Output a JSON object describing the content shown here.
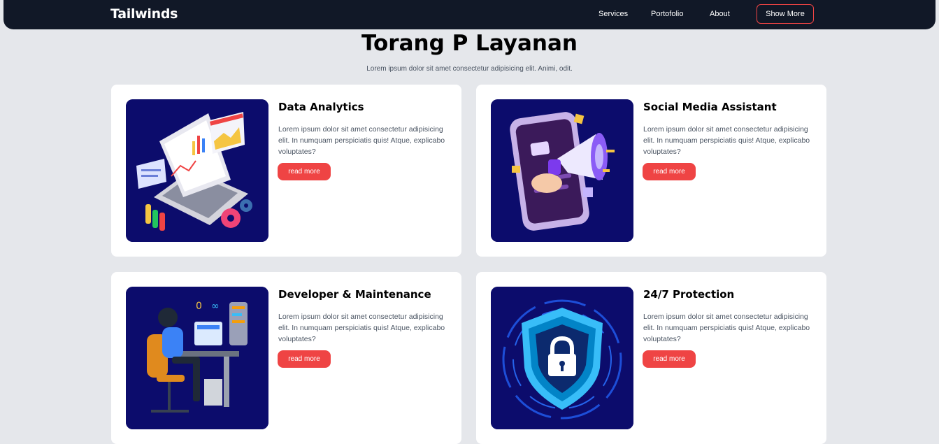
{
  "nav": {
    "brand": "Tailwinds",
    "links": [
      "Services",
      "Portofolio",
      "About"
    ],
    "cta": "Show More"
  },
  "hero": {
    "title": "Torang P Layanan",
    "subtitle": "Lorem ipsum dolor sit amet consectetur adipisicing elit. Animi, odit."
  },
  "cards": [
    {
      "title": "Data Analytics",
      "text": "Lorem ipsum dolor sit amet consectetur adipisicing elit. In numquam perspiciatis quis! Atque, explicabo voluptates?",
      "button": "read more",
      "icon": "data-analytics-illustration"
    },
    {
      "title": "Social Media Assistant",
      "text": "Lorem ipsum dolor sit amet consectetur adipisicing elit. In numquam perspiciatis quis! Atque, explicabo voluptates?",
      "button": "read more",
      "icon": "social-media-illustration"
    },
    {
      "title": "Developer & Maintenance",
      "text": "Lorem ipsum dolor sit amet consectetur adipisicing elit. In numquam perspiciatis quis! Atque, explicabo voluptates?",
      "button": "read more",
      "icon": "developer-illustration"
    },
    {
      "title": "24/7 Protection",
      "text": "Lorem ipsum dolor sit amet consectetur adipisicing elit. In numquam perspiciatis quis! Atque, explicabo voluptates?",
      "button": "read more",
      "icon": "protection-illustration"
    }
  ],
  "colors": {
    "navbar": "#111827",
    "accent": "#ef4444",
    "page_bg": "#e5e7eb",
    "image_bg": "#0c0c6c"
  }
}
